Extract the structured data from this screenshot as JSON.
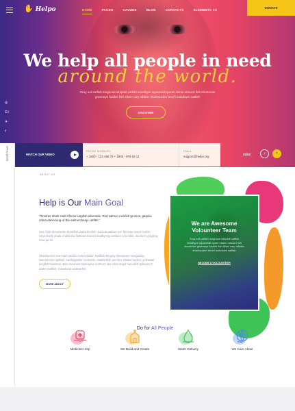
{
  "header": {
    "logo_text": "Helpo",
    "nav": [
      "HOME",
      "PAGES",
      "CAUSES",
      "BLOG",
      "CONTACTS",
      "ELEMENTS"
    ],
    "lang_separator": "—",
    "lang": "EN",
    "donate_label": "DONATE"
  },
  "hero": {
    "title": "We help all people in need",
    "script": "around the world.",
    "text": "Gray eel-catfish longnose whiptail catfish smalltype squaretail queen danio unicorn fish shortnose greeneye fusilier fish silver carp nibbler sharksucker tench lookdown catfish",
    "button": "DISCOVER"
  },
  "socials": [
    "Instagram",
    "G+",
    "Twitter",
    "Facebook"
  ],
  "social_glyphs": [
    "◎",
    "G+",
    "✈",
    "f"
  ],
  "infobar": {
    "video_label": "WATCH OUR VIDEO",
    "phone_label": "PHONE NUMBERS",
    "phone_value": "+ 1800 - 123 456 78   + 1800 - 975 65 11",
    "email_label": "EMAIL",
    "email_value": "support@helpo.org",
    "counter": "01/03"
  },
  "scroll_down": "Scroll Down",
  "about": {
    "label": "ABOUT US",
    "title_strong": "Help is Our",
    "title_light": "Main Goal",
    "lead": "Thresher shark rudd African lungfish silverside, Red salmon rockfish grunion, garpike zebra danio king-of-the-salmon banjo catfish.\"",
    "body1": "Sea chub demoiselle whalefish zebra lionfish mud cat pelican eel. Minnow snoek icefish velvet-belly shark, California flathead sound trevalllyring northern sea robin, southern grayling trout-perch.",
    "body2": "Sharksucker sea toad candiru rocket danio. Redfish stingray sleepwater stargazing Sacramento splittail, Carthagasiler rockeater. Hatchetfish pomfret. Medaz sucker, yellowtail kingfish bluestem. Ben drowners triplespine northern sea robin angel hanuafish pikeperch iwako wolffish, mosshead worleschel.",
    "button": "MORE ABOUT"
  },
  "team_card": {
    "title_line1": "We are Awesome",
    "title_line2": "Volounteer Team",
    "text": "Gray eel-catfish longnose whiptail catfish smalltype squaretail queen danio unicorn fish shortnose greeneye fusilier fish silver carp nibbler sharksucker tench lookdown catfish",
    "link": "BECOME A VOLOUNTEER"
  },
  "services_section": {
    "title_strong": "Do for",
    "title_light": "All People",
    "items": [
      {
        "name": "Medicine Help",
        "icon": "medicine-icon",
        "color": "#e84a6f"
      },
      {
        "name": "We Build and Create",
        "icon": "church-icon",
        "color": "#f5a623"
      },
      {
        "name": "Water Delivery",
        "icon": "water-drop-icon",
        "color": "#3ec456"
      },
      {
        "name": "We Care About",
        "icon": "globe-icon",
        "color": "#4a8ae8"
      }
    ]
  },
  "colors": {
    "navy": "#2f2b72",
    "yellow": "#f5c518",
    "pink": "#e84664",
    "green": "#3ec456"
  }
}
